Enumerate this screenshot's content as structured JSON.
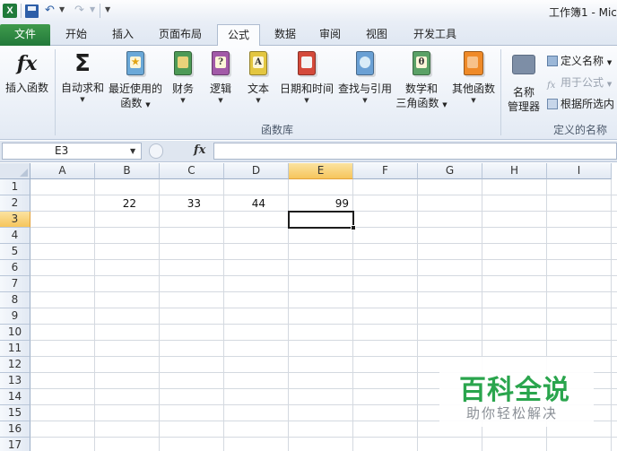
{
  "titlebar": {
    "title": "工作簿1 - Mic",
    "excel_icon_letter": "X"
  },
  "tabs": [
    {
      "label": "文件",
      "kind": "file"
    },
    {
      "label": "开始"
    },
    {
      "label": "插入"
    },
    {
      "label": "页面布局"
    },
    {
      "label": "公式",
      "active": true
    },
    {
      "label": "数据"
    },
    {
      "label": "审阅"
    },
    {
      "label": "视图"
    },
    {
      "label": "开发工具"
    }
  ],
  "ribbon": {
    "insert_function": "插入函数",
    "autosum": "自动求和",
    "recent_line1": "最近使用的",
    "recent_line2": "函数",
    "financial": "财务",
    "logical": "逻辑",
    "text": "文本",
    "datetime": "日期和时间",
    "lookup": "查找与引用",
    "math_line1": "数学和",
    "math_line2": "三角函数",
    "other": "其他函数",
    "name_manager_line1": "名称",
    "name_manager_line2": "管理器",
    "define_name": "定义名称",
    "use_in_formula": "用于公式",
    "create_from_selection": "根据所选内",
    "group_function_library": "函数库",
    "group_defined_names": "定义的名称",
    "icon_glyphs": {
      "fx": "fx",
      "sigma": "Σ",
      "star": "★",
      "logical": "?",
      "text": "A",
      "math": "θ"
    }
  },
  "formula_bar": {
    "name_box": "E3",
    "fx_label": "fx",
    "formula": ""
  },
  "sheet": {
    "columns": [
      "A",
      "B",
      "C",
      "D",
      "E",
      "F",
      "G",
      "H",
      "I"
    ],
    "rows": [
      "1",
      "2",
      "3",
      "4",
      "5",
      "6",
      "7",
      "8",
      "9",
      "10",
      "11",
      "12",
      "13",
      "14",
      "15",
      "16",
      "17"
    ],
    "selected_column": "E",
    "selected_row": "3",
    "cells": {
      "B2": "22",
      "C2": "33",
      "D2": "44",
      "E2": "99"
    }
  },
  "watermark": {
    "title": "百科全说",
    "subtitle": "助你轻松解决"
  },
  "colors": {
    "file_tab": "#2e8b45",
    "selection_header": "#f6c55c",
    "watermark_green": "#2aa54d"
  }
}
